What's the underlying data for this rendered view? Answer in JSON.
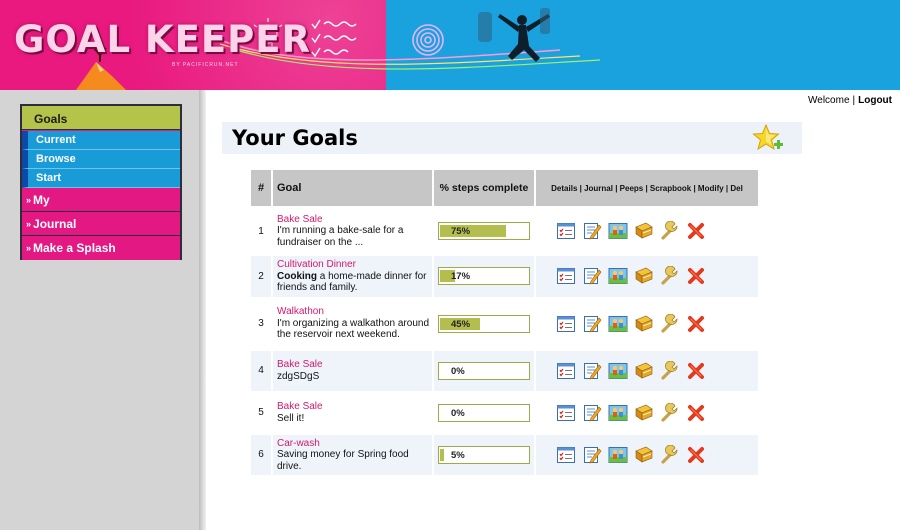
{
  "brand": {
    "logo_text": "GOAL KEEPER",
    "logo_sub": "BY PACIFICRUN.NET",
    "colors": {
      "pink": "#e9197f",
      "blue": "#1aa2df",
      "lime": "#b4c34a"
    }
  },
  "header": {
    "welcome": "Welcome",
    "separator": "|",
    "logout": "Logout"
  },
  "sidebar": {
    "goals": "Goals",
    "sub_items": [
      "Current",
      "Browse",
      "Start"
    ],
    "main_items": [
      "My",
      "Journal",
      "Make a Splash"
    ],
    "arrow": "»"
  },
  "page": {
    "title": "Your Goals",
    "add_icon": "star-plus-icon"
  },
  "table": {
    "headers": {
      "num": "#",
      "goal": "Goal",
      "pct": "% steps complete",
      "actions": "Details | Journal | Peeps | Scrapbook | Modify | Del"
    },
    "action_icons": [
      "details-icon",
      "journal-icon",
      "peeps-icon",
      "scrapbook-icon",
      "modify-icon",
      "delete-icon"
    ],
    "rows": [
      {
        "num": "1",
        "title": "Bake Sale",
        "desc_bold": "",
        "desc": "I'm running a bake-sale for a fundraiser on the ...",
        "pct_label": "75%",
        "pct": 75
      },
      {
        "num": "2",
        "title": "Cultivation Dinner",
        "desc_bold": "Cooking",
        "desc": " a home-made dinner for friends and family.",
        "pct_label": "17%",
        "pct": 17
      },
      {
        "num": "3",
        "title": "Walkathon",
        "desc_bold": "",
        "desc": "I'm organizing a walkathon around the reservoir next weekend.",
        "pct_label": "45%",
        "pct": 45
      },
      {
        "num": "4",
        "title": "Bake Sale",
        "desc_bold": "",
        "desc": "zdgSDgS",
        "pct_label": "0%",
        "pct": 0
      },
      {
        "num": "5",
        "title": "Bake Sale",
        "desc_bold": "",
        "desc": "Sell it!",
        "pct_label": "0%",
        "pct": 0
      },
      {
        "num": "6",
        "title": "Car-wash",
        "desc_bold": "",
        "desc": "Saving money for Spring food drive.",
        "pct_label": "5%",
        "pct": 5
      }
    ]
  }
}
